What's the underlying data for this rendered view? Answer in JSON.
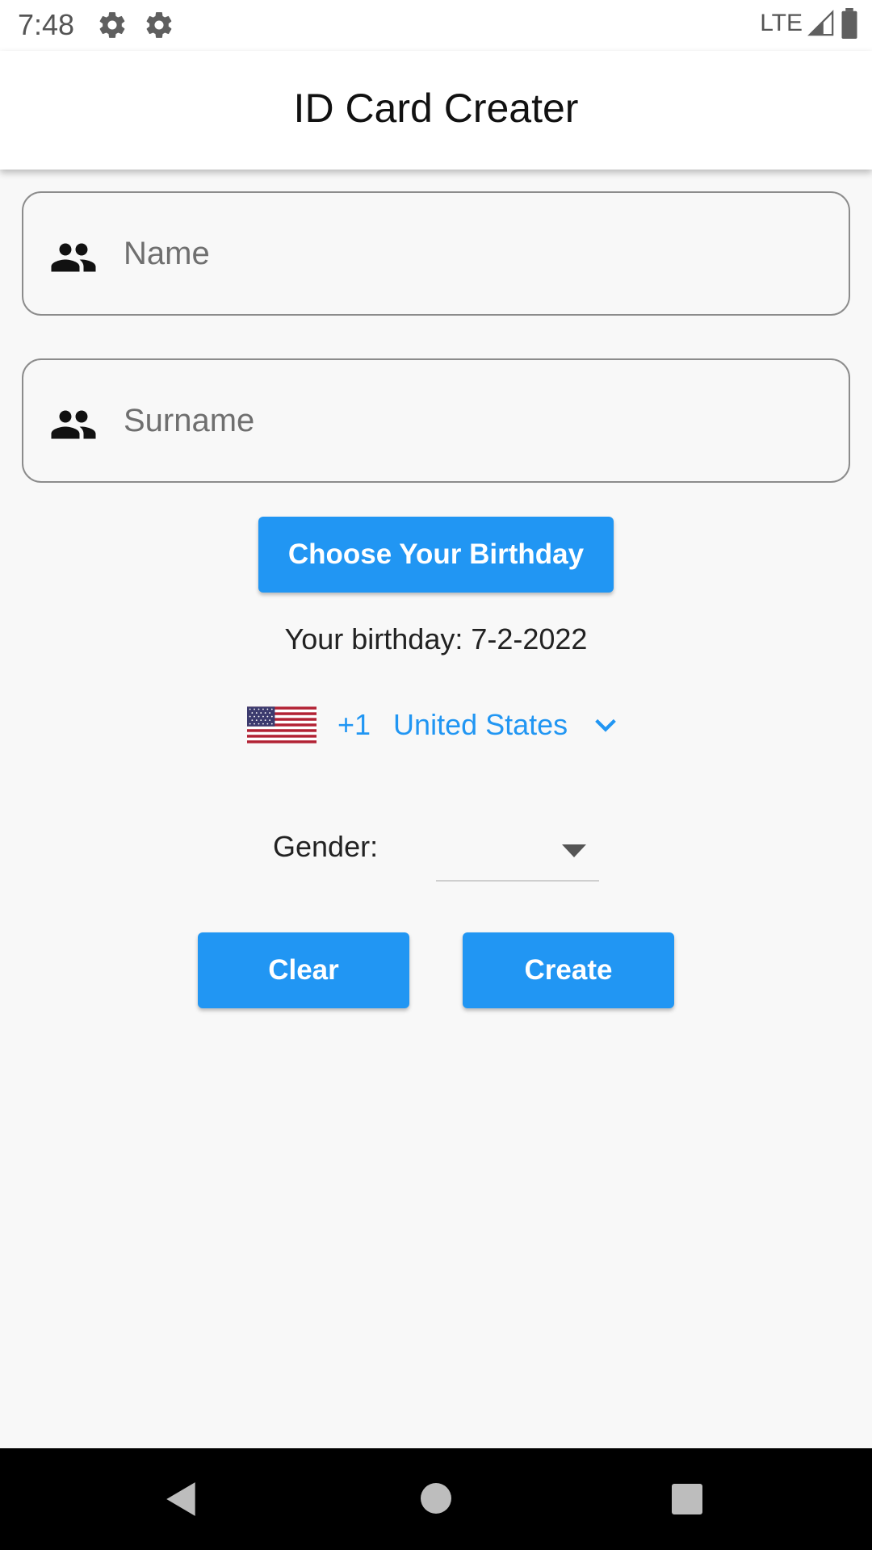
{
  "status_bar": {
    "time": "7:48",
    "network": "LTE",
    "icons": [
      "gear-icon",
      "gear-icon",
      "signal-icon",
      "battery-icon"
    ]
  },
  "app_bar": {
    "title": "ID Card Creater"
  },
  "form": {
    "name_field": {
      "placeholder": "Name",
      "value": "",
      "icon": "people-icon"
    },
    "surname_field": {
      "placeholder": "Surname",
      "value": "",
      "icon": "people-icon"
    },
    "birthday_button": "Choose Your Birthday",
    "birthday_text": "Your birthday: 7-2-2022",
    "country": {
      "flag": "us-flag-icon",
      "dial_code": "+1",
      "name": "United States",
      "chevron": "chevron-down-icon"
    },
    "gender_label": "Gender:",
    "gender_value": "",
    "clear_button": "Clear",
    "create_button": "Create"
  },
  "colors": {
    "accent": "#2196f3",
    "app_bar": "#ffffff",
    "background": "#f8f8f8",
    "nav_bar": "#000000"
  },
  "nav_bar": {
    "icons": [
      "back-icon",
      "home-icon",
      "recents-icon"
    ]
  }
}
